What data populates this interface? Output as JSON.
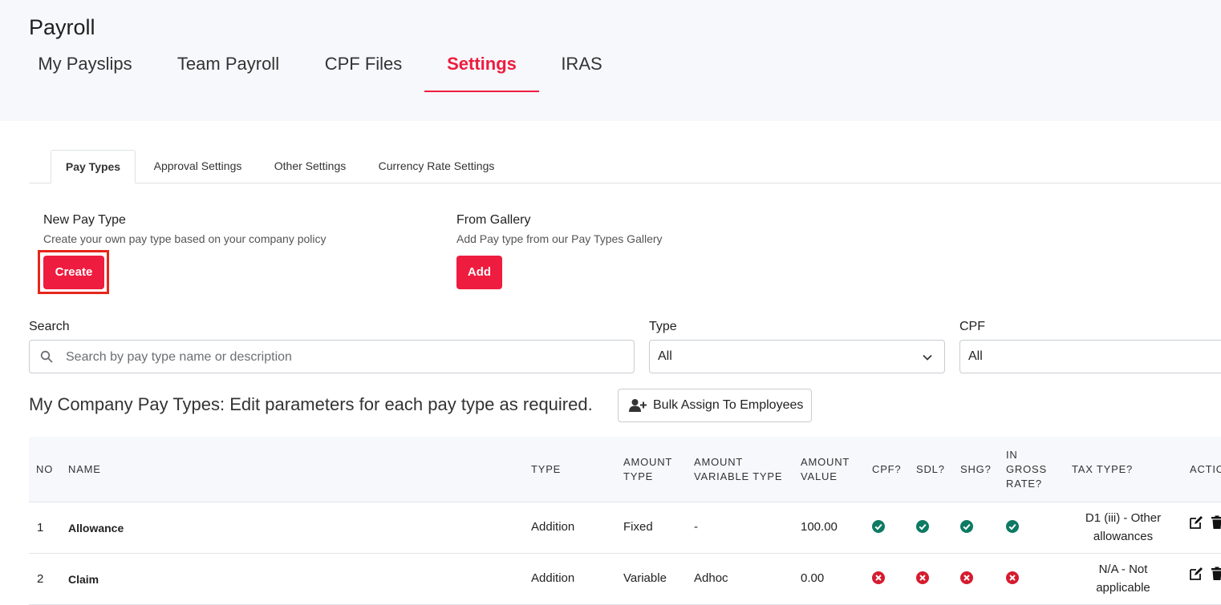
{
  "app": {
    "title": "Payroll"
  },
  "main_tabs": [
    {
      "label": "My Payslips"
    },
    {
      "label": "Team Payroll"
    },
    {
      "label": "CPF Files"
    },
    {
      "label": "Settings"
    },
    {
      "label": "IRAS"
    }
  ],
  "sub_tabs": [
    {
      "label": "Pay Types"
    },
    {
      "label": "Approval Settings"
    },
    {
      "label": "Other Settings"
    },
    {
      "label": "Currency Rate Settings"
    }
  ],
  "new_pay_type": {
    "title": "New Pay Type",
    "desc": "Create your own pay type based on your company policy",
    "button": "Create"
  },
  "from_gallery": {
    "title": "From Gallery",
    "desc": "Add Pay type from our Pay Types Gallery",
    "button": "Add"
  },
  "filters": {
    "search_label": "Search",
    "search_placeholder": "Search by pay type name or description",
    "type_label": "Type",
    "type_value": "All",
    "cpf_label": "CPF",
    "cpf_value": "All"
  },
  "section": {
    "title": "My Company Pay Types: Edit parameters for each pay type as required.",
    "bulk_button": "Bulk Assign To Employees"
  },
  "table": {
    "headers": {
      "no": "NO",
      "name": "NAME",
      "type": "TYPE",
      "amount_type_1": "AMOUNT",
      "amount_type_2": "TYPE",
      "amount_var_1": "AMOUNT",
      "amount_var_2": "VARIABLE TYPE",
      "amount_value_1": "AMOUNT",
      "amount_value_2": "VALUE",
      "cpf": "CPF?",
      "sdl": "SDL?",
      "shg": "SHG?",
      "gross_1": "IN",
      "gross_2": "GROSS",
      "gross_3": "RATE?",
      "tax": "TAX TYPE?",
      "action": "ACTIO"
    },
    "rows": [
      {
        "no": "1",
        "name": "Allowance",
        "type": "Addition",
        "amount_type": "Fixed",
        "variable_type": "-",
        "value": "100.00",
        "cpf": true,
        "sdl": true,
        "shg": true,
        "gross": true,
        "tax_1": "D1 (iii) - Other",
        "tax_2": "allowances"
      },
      {
        "no": "2",
        "name": "Claim",
        "type": "Addition",
        "amount_type": "Variable",
        "variable_type": "Adhoc",
        "value": "0.00",
        "cpf": false,
        "sdl": false,
        "shg": false,
        "gross": false,
        "tax_1": "N/A - Not",
        "tax_2": "applicable"
      }
    ]
  },
  "colors": {
    "accent": "#ee1c3f",
    "check": "#0d7a63",
    "cross": "#d61b2f"
  }
}
